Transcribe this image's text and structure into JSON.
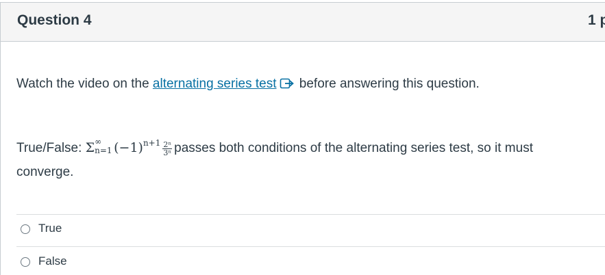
{
  "question": {
    "title": "Question 4",
    "points": "1 p"
  },
  "instruction": {
    "prefix": "Watch the video on the ",
    "link_text": "alternating series test",
    "link_icon": "external-link-icon",
    "suffix": " before answering this question."
  },
  "statement": {
    "prefix": "True/False: ",
    "math": {
      "sigma": "Σ",
      "upper": "∞",
      "lower": "n=1",
      "term": "(−1)",
      "exponent": "n+1",
      "numerator": "2ⁿ",
      "denominator": "3ⁿ"
    },
    "suffix": "passes both conditions of the alternating series test, so it must",
    "continuation": "converge."
  },
  "answers": [
    {
      "label": "True",
      "selected": false
    },
    {
      "label": "False",
      "selected": false
    }
  ],
  "colors": {
    "link": "#0770a3",
    "header_bg": "#f5f5f5",
    "text": "#2d3b45"
  }
}
